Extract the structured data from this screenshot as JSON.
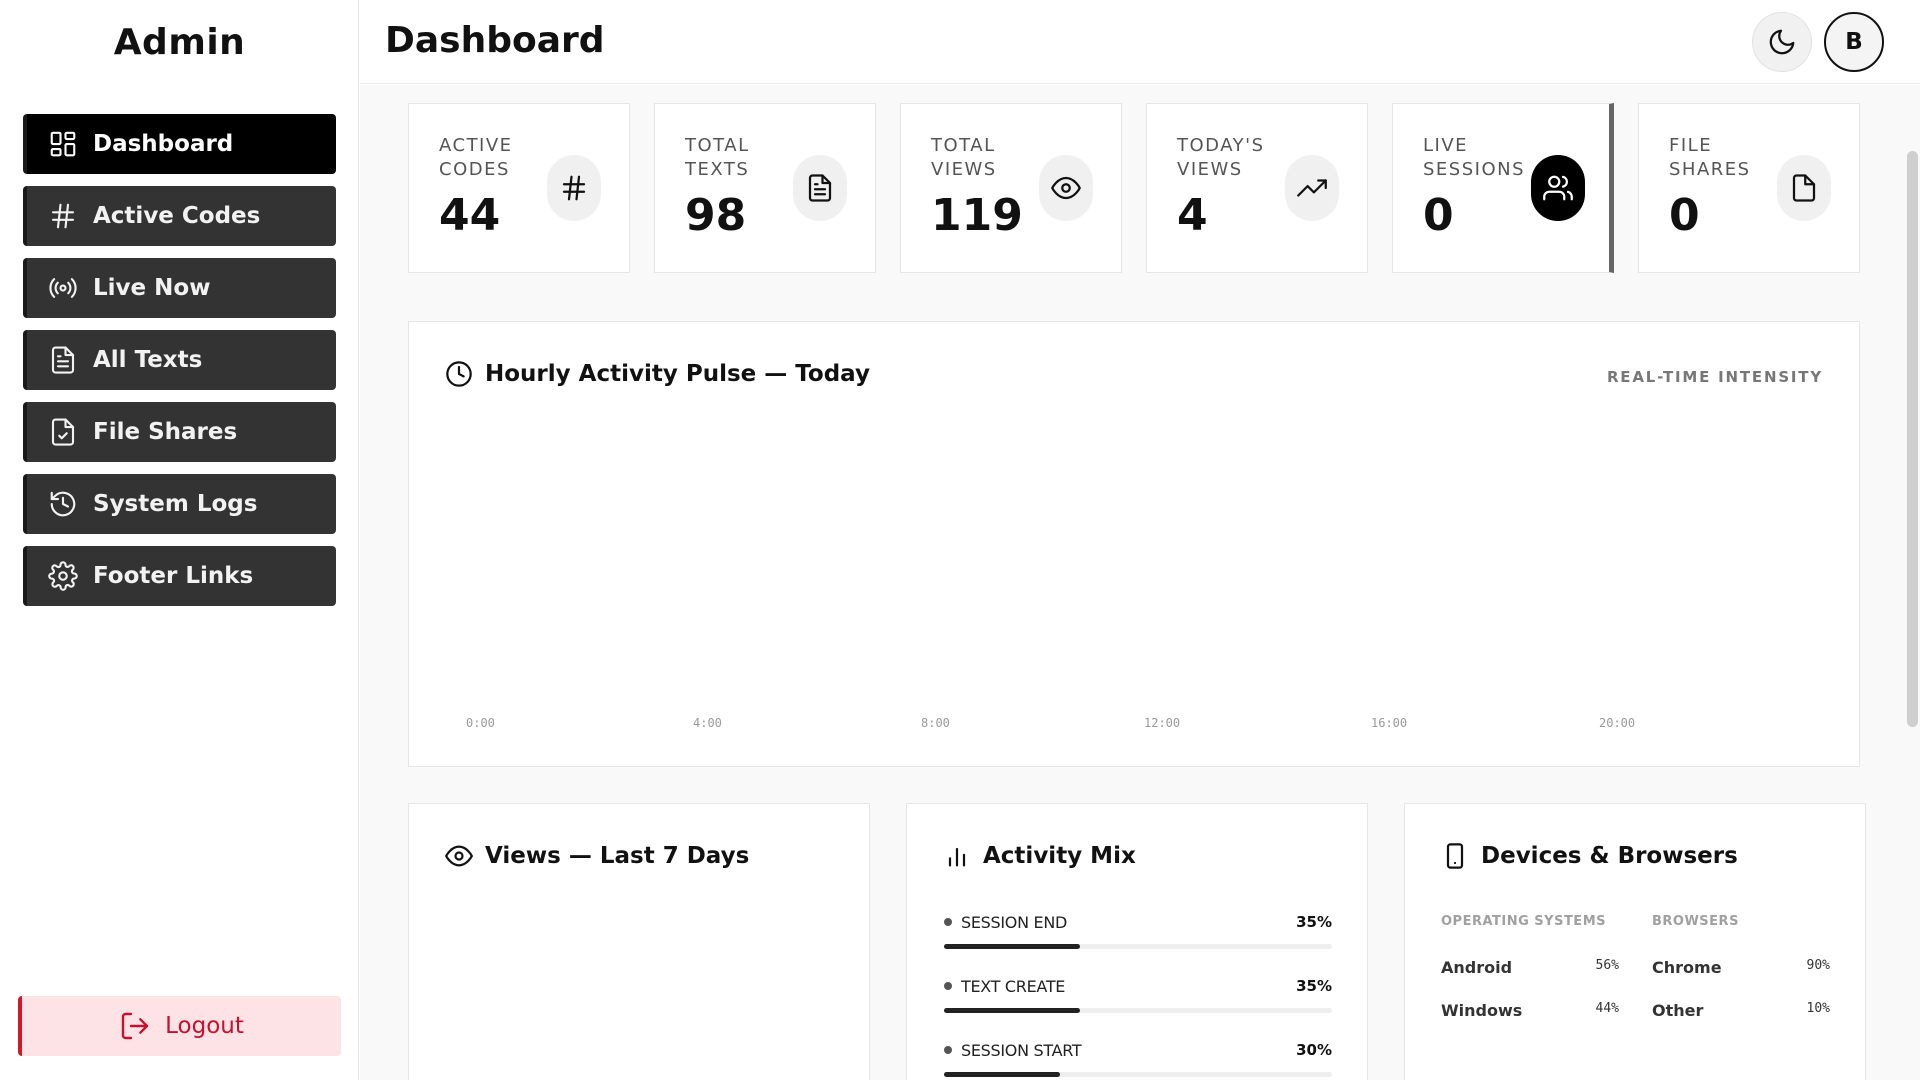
{
  "sidebar": {
    "brand": "Admin",
    "items": [
      {
        "label": "Dashboard",
        "icon": "layout-grid-icon",
        "active": true
      },
      {
        "label": "Active Codes",
        "icon": "hash-icon"
      },
      {
        "label": "Live Now",
        "icon": "broadcast-icon"
      },
      {
        "label": "All Texts",
        "icon": "file-text-icon"
      },
      {
        "label": "File Shares",
        "icon": "file-check-icon"
      },
      {
        "label": "System Logs",
        "icon": "history-icon"
      },
      {
        "label": "Footer Links",
        "icon": "gear-icon"
      }
    ],
    "logout": "Logout"
  },
  "header": {
    "title": "Dashboard",
    "avatar_initial": "B"
  },
  "stats": [
    {
      "label": "ACTIVE CODES",
      "value": "44",
      "icon": "hash-icon"
    },
    {
      "label": "TOTAL TEXTS",
      "value": "98",
      "icon": "document-icon"
    },
    {
      "label": "TOTAL VIEWS",
      "value": "119",
      "icon": "eye-icon"
    },
    {
      "label": "TODAY'S VIEWS",
      "value": "4",
      "icon": "trending-up-icon"
    },
    {
      "label": "LIVE SESSIONS",
      "value": "0",
      "icon": "users-icon"
    },
    {
      "label": "FILE SHARES",
      "value": "0",
      "icon": "file-icon"
    }
  ],
  "pulse": {
    "title": "Hourly Activity Pulse — Today",
    "tag": "REAL-TIME INTENSITY",
    "axis": [
      "0:00",
      "4:00",
      "8:00",
      "12:00",
      "16:00",
      "20:00"
    ]
  },
  "views7": {
    "title": "Views — Last 7 Days"
  },
  "mix": {
    "title": "Activity Mix",
    "items": [
      {
        "name": "SESSION END",
        "pct": "35%",
        "value": 35
      },
      {
        "name": "TEXT CREATE",
        "pct": "35%",
        "value": 35
      },
      {
        "name": "SESSION START",
        "pct": "30%",
        "value": 30
      }
    ]
  },
  "devices": {
    "title": "Devices & Browsers",
    "os_title": "OPERATING SYSTEMS",
    "browser_title": "BROWSERS",
    "os": [
      {
        "name": "Android",
        "pct": "56%"
      },
      {
        "name": "Windows",
        "pct": "44%"
      }
    ],
    "browsers": [
      {
        "name": "Chrome",
        "pct": "90%"
      },
      {
        "name": "Other",
        "pct": "10%"
      }
    ]
  }
}
